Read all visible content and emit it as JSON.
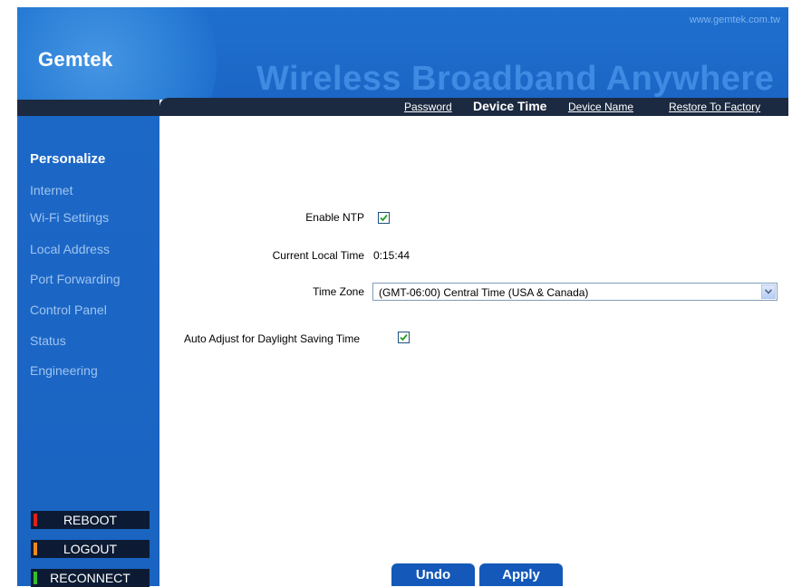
{
  "header": {
    "site_url": "www.gemtek.com.tw",
    "logo": "Gemtek",
    "slogan": "Wireless Broadband Anywhere"
  },
  "subnav": {
    "items": [
      {
        "label": "Password",
        "active": false
      },
      {
        "label": "Device Time",
        "active": true
      },
      {
        "label": "Device Name",
        "active": false
      },
      {
        "label": "Restore To Factory",
        "active": false
      }
    ]
  },
  "sidebar": {
    "items": [
      {
        "label": "Personalize",
        "active": true
      },
      {
        "label": "Internet",
        "active": false
      },
      {
        "label": "Wi-Fi Settings",
        "active": false
      },
      {
        "label": "Local Address",
        "active": false
      },
      {
        "label": "Port Forwarding",
        "active": false
      },
      {
        "label": "Control Panel",
        "active": false
      },
      {
        "label": "Status",
        "active": false
      },
      {
        "label": "Engineering",
        "active": false
      }
    ],
    "commands": [
      {
        "label": "REBOOT",
        "color": "#e0201c"
      },
      {
        "label": "LOGOUT",
        "color": "#f08a1c"
      },
      {
        "label": "RECONNECT",
        "color": "#2fbf2f"
      }
    ]
  },
  "form": {
    "enable_ntp_label": "Enable NTP",
    "enable_ntp_checked": true,
    "current_time_label": "Current Local Time",
    "current_time_value": "0:15:44",
    "time_zone_label": "Time Zone",
    "time_zone_value": "(GMT-06:00) Central Time (USA & Canada)",
    "dst_label": "Auto Adjust for Daylight Saving Time",
    "dst_checked": true
  },
  "buttons": {
    "undo": "Undo",
    "apply": "Apply"
  },
  "colors": {
    "header_blue": "#1f6fcf",
    "dark_band": "#1b2a40",
    "button_blue": "#1459b9"
  }
}
